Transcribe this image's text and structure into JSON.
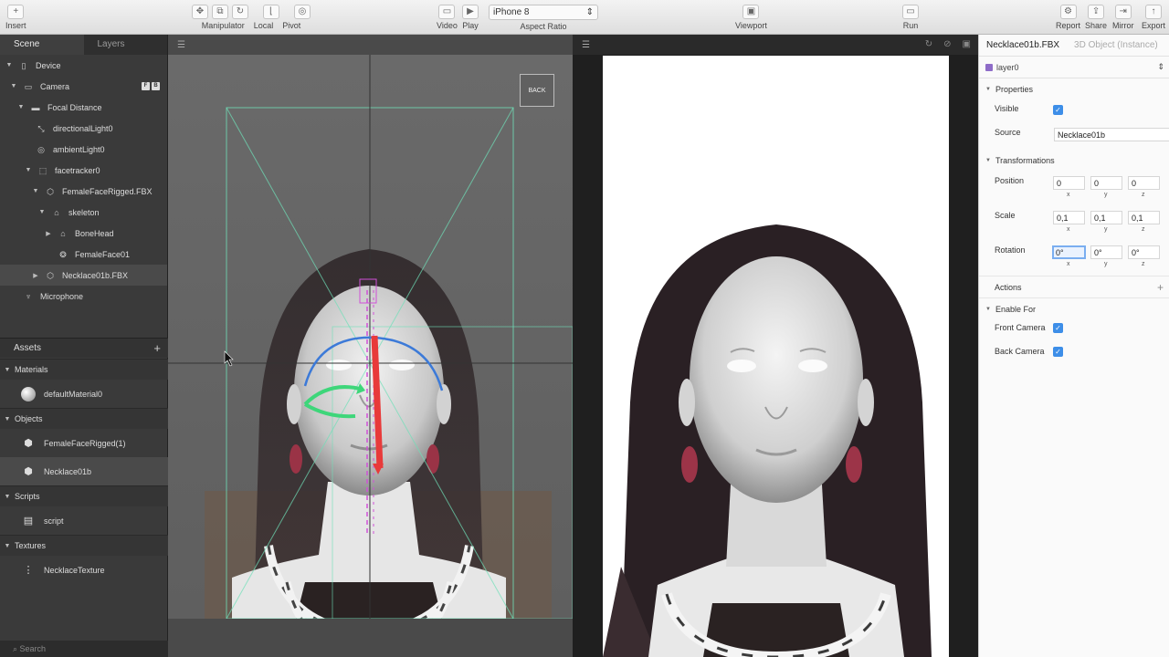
{
  "toolbar": {
    "insert": "Insert",
    "manipulator": "Manipulator",
    "local": "Local",
    "pivot": "Pivot",
    "video": "Video",
    "play": "Play",
    "device": "iPhone 8",
    "aspect_ratio": "Aspect Ratio",
    "viewport": "Viewport",
    "run": "Run",
    "report": "Report",
    "share": "Share",
    "mirror": "Mirror",
    "export": "Export"
  },
  "scene_panel": {
    "tabs": [
      "Scene",
      "Layers"
    ],
    "tree": [
      {
        "label": "Device",
        "icon": "phone-icon"
      },
      {
        "label": "Camera",
        "icon": "camera-icon",
        "badges": [
          "F",
          "B"
        ]
      },
      {
        "label": "Focal Distance",
        "icon": "focal-distance-icon"
      },
      {
        "label": "directionalLight0",
        "icon": "directional-light-icon"
      },
      {
        "label": "ambientLight0",
        "icon": "ambient-light-icon"
      },
      {
        "label": "facetracker0",
        "icon": "facetracker-icon"
      },
      {
        "label": "FemaleFaceRigged.FBX",
        "icon": "cube-icon"
      },
      {
        "label": "skeleton",
        "icon": "skeleton-icon"
      },
      {
        "label": "BoneHead",
        "icon": "bone-icon"
      },
      {
        "label": "FemaleFace01",
        "icon": "mesh-icon"
      },
      {
        "label": "Necklace01b.FBX",
        "icon": "cube-icon"
      },
      {
        "label": "Microphone",
        "icon": "microphone-icon"
      }
    ]
  },
  "assets": {
    "title": "Assets",
    "add": "+",
    "categories": [
      {
        "label": "Materials",
        "items": [
          "defaultMaterial0"
        ]
      },
      {
        "label": "Objects",
        "items": [
          "FemaleFaceRigged(1)",
          "Necklace01b"
        ]
      },
      {
        "label": "Scripts",
        "items": [
          "script"
        ]
      },
      {
        "label": "Textures",
        "items": [
          "NecklaceTexture"
        ]
      }
    ],
    "search": "Search"
  },
  "viewport": {
    "back": "BACK"
  },
  "inspector": {
    "title": "Necklace01b.FBX",
    "subtitle": "3D Object (Instance)",
    "layer": "layer0",
    "properties": "Properties",
    "visible_label": "Visible",
    "source_label": "Source",
    "source_value": "Necklace01b",
    "transformations": "Transformations",
    "position_label": "Position",
    "position": [
      "0",
      "0",
      "0"
    ],
    "scale_label": "Scale",
    "scale": [
      "0,1",
      "0,1",
      "0,1"
    ],
    "rotation_label": "Rotation",
    "rotation": [
      "0°",
      "0°",
      "0°"
    ],
    "axes": [
      "x",
      "y",
      "z"
    ],
    "actions": "Actions",
    "actions_add": "+",
    "enable_for": "Enable For",
    "front_camera": "Front Camera",
    "back_camera": "Back Camera"
  },
  "colors": {
    "accent": "#3d8ee8",
    "layer": "#8e6cc8",
    "gizmo_red": "#e83a3a",
    "gizmo_green": "#3ed67a",
    "gizmo_blue": "#3c7ad8",
    "frustum": "#6fe0b8"
  }
}
